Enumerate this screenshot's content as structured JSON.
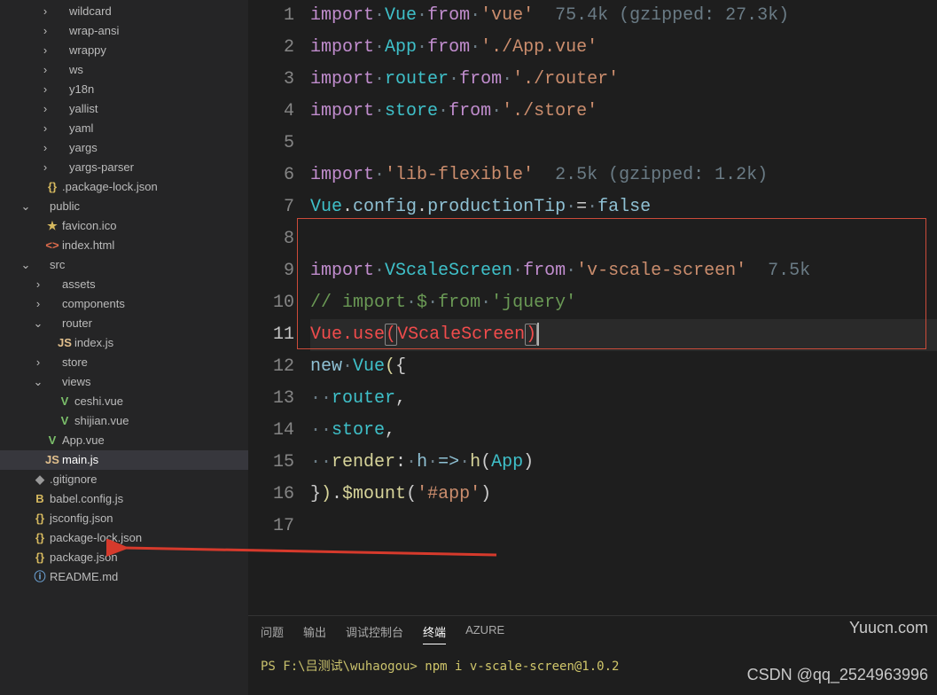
{
  "sidebar": {
    "items": [
      {
        "label": "wildcard",
        "indent": 44,
        "chev": "›",
        "icon": "",
        "cls": ""
      },
      {
        "label": "wrap-ansi",
        "indent": 44,
        "chev": "›",
        "icon": "",
        "cls": ""
      },
      {
        "label": "wrappy",
        "indent": 44,
        "chev": "›",
        "icon": "",
        "cls": ""
      },
      {
        "label": "ws",
        "indent": 44,
        "chev": "›",
        "icon": "",
        "cls": ""
      },
      {
        "label": "y18n",
        "indent": 44,
        "chev": "›",
        "icon": "",
        "cls": ""
      },
      {
        "label": "yallist",
        "indent": 44,
        "chev": "›",
        "icon": "",
        "cls": ""
      },
      {
        "label": "yaml",
        "indent": 44,
        "chev": "›",
        "icon": "",
        "cls": ""
      },
      {
        "label": "yargs",
        "indent": 44,
        "chev": "›",
        "icon": "",
        "cls": ""
      },
      {
        "label": "yargs-parser",
        "indent": 44,
        "chev": "›",
        "icon": "",
        "cls": ""
      },
      {
        "label": ".package-lock.json",
        "indent": 36,
        "chev": "",
        "icon": "{}",
        "cls": "yellow"
      },
      {
        "label": "public",
        "indent": 22,
        "chev": "⌄",
        "icon": "",
        "cls": ""
      },
      {
        "label": "favicon.ico",
        "indent": 36,
        "chev": "",
        "icon": "★",
        "cls": "yellow"
      },
      {
        "label": "index.html",
        "indent": 36,
        "chev": "",
        "icon": "<>",
        "cls": "orange"
      },
      {
        "label": "src",
        "indent": 22,
        "chev": "⌄",
        "icon": "",
        "cls": ""
      },
      {
        "label": "assets",
        "indent": 36,
        "chev": "›",
        "icon": "",
        "cls": ""
      },
      {
        "label": "components",
        "indent": 36,
        "chev": "›",
        "icon": "",
        "cls": ""
      },
      {
        "label": "router",
        "indent": 36,
        "chev": "⌄",
        "icon": "",
        "cls": ""
      },
      {
        "label": "index.js",
        "indent": 50,
        "chev": "",
        "icon": "JS",
        "cls": "jsy"
      },
      {
        "label": "store",
        "indent": 36,
        "chev": "›",
        "icon": "",
        "cls": ""
      },
      {
        "label": "views",
        "indent": 36,
        "chev": "⌄",
        "icon": "",
        "cls": ""
      },
      {
        "label": "ceshi.vue",
        "indent": 50,
        "chev": "",
        "icon": "V",
        "cls": "green"
      },
      {
        "label": "shijian.vue",
        "indent": 50,
        "chev": "",
        "icon": "V",
        "cls": "green"
      },
      {
        "label": "App.vue",
        "indent": 36,
        "chev": "",
        "icon": "V",
        "cls": "green"
      },
      {
        "label": "main.js",
        "indent": 36,
        "chev": "",
        "icon": "JS",
        "cls": "jsy",
        "active": true
      },
      {
        "label": ".gitignore",
        "indent": 22,
        "chev": "",
        "icon": "◆",
        "cls": "gray"
      },
      {
        "label": "babel.config.js",
        "indent": 22,
        "chev": "",
        "icon": "B",
        "cls": "yellow"
      },
      {
        "label": "jsconfig.json",
        "indent": 22,
        "chev": "",
        "icon": "{}",
        "cls": "yellow"
      },
      {
        "label": "package-lock.json",
        "indent": 22,
        "chev": "",
        "icon": "{}",
        "cls": "yellow"
      },
      {
        "label": "package.json",
        "indent": 22,
        "chev": "",
        "icon": "{}",
        "cls": "yellow"
      },
      {
        "label": "README.md",
        "indent": 22,
        "chev": "",
        "icon": "ⓘ",
        "cls": "blue"
      }
    ]
  },
  "editor": {
    "lines": [
      [
        {
          "t": "import",
          "c": "kw"
        },
        {
          "t": "·",
          "c": "dot"
        },
        {
          "t": "Vue",
          "c": "id"
        },
        {
          "t": "·",
          "c": "dot"
        },
        {
          "t": "from",
          "c": "kw"
        },
        {
          "t": "·",
          "c": "dot"
        },
        {
          "t": "'vue'",
          "c": "str"
        },
        {
          "t": "  75.4k (gzipped: 27.3k)",
          "c": "info"
        }
      ],
      [
        {
          "t": "import",
          "c": "kw"
        },
        {
          "t": "·",
          "c": "dot"
        },
        {
          "t": "App",
          "c": "id"
        },
        {
          "t": "·",
          "c": "dot"
        },
        {
          "t": "from",
          "c": "kw"
        },
        {
          "t": "·",
          "c": "dot"
        },
        {
          "t": "'./App.vue'",
          "c": "str"
        }
      ],
      [
        {
          "t": "import",
          "c": "kw"
        },
        {
          "t": "·",
          "c": "dot"
        },
        {
          "t": "router",
          "c": "id"
        },
        {
          "t": "·",
          "c": "dot"
        },
        {
          "t": "from",
          "c": "kw"
        },
        {
          "t": "·",
          "c": "dot"
        },
        {
          "t": "'./router'",
          "c": "str"
        }
      ],
      [
        {
          "t": "import",
          "c": "kw"
        },
        {
          "t": "·",
          "c": "dot"
        },
        {
          "t": "store",
          "c": "id"
        },
        {
          "t": "·",
          "c": "dot"
        },
        {
          "t": "from",
          "c": "kw"
        },
        {
          "t": "·",
          "c": "dot"
        },
        {
          "t": "'./store'",
          "c": "str"
        }
      ],
      [],
      [
        {
          "t": "import",
          "c": "kw"
        },
        {
          "t": "·",
          "c": "dot"
        },
        {
          "t": "'lib-flexible'",
          "c": "str"
        },
        {
          "t": "  2.5k (gzipped: 1.2k)",
          "c": "info"
        }
      ],
      [
        {
          "t": "Vue",
          "c": "id"
        },
        {
          "t": ".",
          "c": "op"
        },
        {
          "t": "config",
          "c": "pr"
        },
        {
          "t": ".",
          "c": "op"
        },
        {
          "t": "productionTip",
          "c": "pr"
        },
        {
          "t": "·",
          "c": "dot"
        },
        {
          "t": "=",
          "c": "op"
        },
        {
          "t": "·",
          "c": "dot"
        },
        {
          "t": "false",
          "c": "pr"
        }
      ],
      [],
      [
        {
          "t": "import",
          "c": "kw"
        },
        {
          "t": "·",
          "c": "dot"
        },
        {
          "t": "VScaleScreen",
          "c": "id"
        },
        {
          "t": "·",
          "c": "dot"
        },
        {
          "t": "from",
          "c": "kw"
        },
        {
          "t": "·",
          "c": "dot"
        },
        {
          "t": "'v-scale-screen'",
          "c": "str"
        },
        {
          "t": "  7.5k",
          "c": "info"
        }
      ],
      [
        {
          "t": "// ",
          "c": "com"
        },
        {
          "t": "import",
          "c": "com"
        },
        {
          "t": "·",
          "c": "dot"
        },
        {
          "t": "$",
          "c": "com"
        },
        {
          "t": "·",
          "c": "dot"
        },
        {
          "t": "from",
          "c": "com"
        },
        {
          "t": "·",
          "c": "dot"
        },
        {
          "t": "'jquery'",
          "c": "com"
        }
      ],
      [
        {
          "t": "Vue",
          "c": "red"
        },
        {
          "t": ".",
          "c": "red"
        },
        {
          "t": "use",
          "c": "red"
        },
        {
          "t": "(",
          "c": "red paren-hl"
        },
        {
          "t": "VScaleScreen",
          "c": "red"
        },
        {
          "t": ")",
          "c": "red paren-hl"
        },
        {
          "t": "",
          "c": "cursor-slot"
        }
      ],
      [
        {
          "t": "new",
          "c": "pr"
        },
        {
          "t": "·",
          "c": "dot"
        },
        {
          "t": "Vue",
          "c": "id"
        },
        {
          "t": "(",
          "c": "fn"
        },
        {
          "t": "{",
          "c": "op"
        }
      ],
      [
        {
          "t": "··",
          "c": "dot"
        },
        {
          "t": "router",
          "c": "id"
        },
        {
          "t": ",",
          "c": "op"
        }
      ],
      [
        {
          "t": "··",
          "c": "dot"
        },
        {
          "t": "store",
          "c": "id"
        },
        {
          "t": ",",
          "c": "op"
        }
      ],
      [
        {
          "t": "··",
          "c": "dot"
        },
        {
          "t": "render",
          "c": "fn"
        },
        {
          "t": ":",
          "c": "op"
        },
        {
          "t": "·",
          "c": "dot"
        },
        {
          "t": "h",
          "c": "pr"
        },
        {
          "t": "·",
          "c": "dot"
        },
        {
          "t": "=>",
          "c": "pr"
        },
        {
          "t": "·",
          "c": "dot"
        },
        {
          "t": "h",
          "c": "fn"
        },
        {
          "t": "(",
          "c": "op"
        },
        {
          "t": "App",
          "c": "id"
        },
        {
          "t": ")",
          "c": "op"
        }
      ],
      [
        {
          "t": "}",
          "c": "op"
        },
        {
          "t": ")",
          "c": "fn"
        },
        {
          "t": ".",
          "c": "op"
        },
        {
          "t": "$mount",
          "c": "fn"
        },
        {
          "t": "(",
          "c": "op"
        },
        {
          "t": "'#app'",
          "c": "str"
        },
        {
          "t": ")",
          "c": "op"
        }
      ],
      []
    ],
    "current_line": 11
  },
  "terminal": {
    "tabs": [
      "问题",
      "输出",
      "调试控制台",
      "终端",
      "AZURE"
    ],
    "active_tab": 3,
    "prompt": "PS F:\\吕测试\\wuhaogou>",
    "command": "npm i v-scale-screen@1.0.2"
  },
  "watermark_right": "Yuucn.com",
  "watermark_csdn": "CSDN @qq_2524963996"
}
